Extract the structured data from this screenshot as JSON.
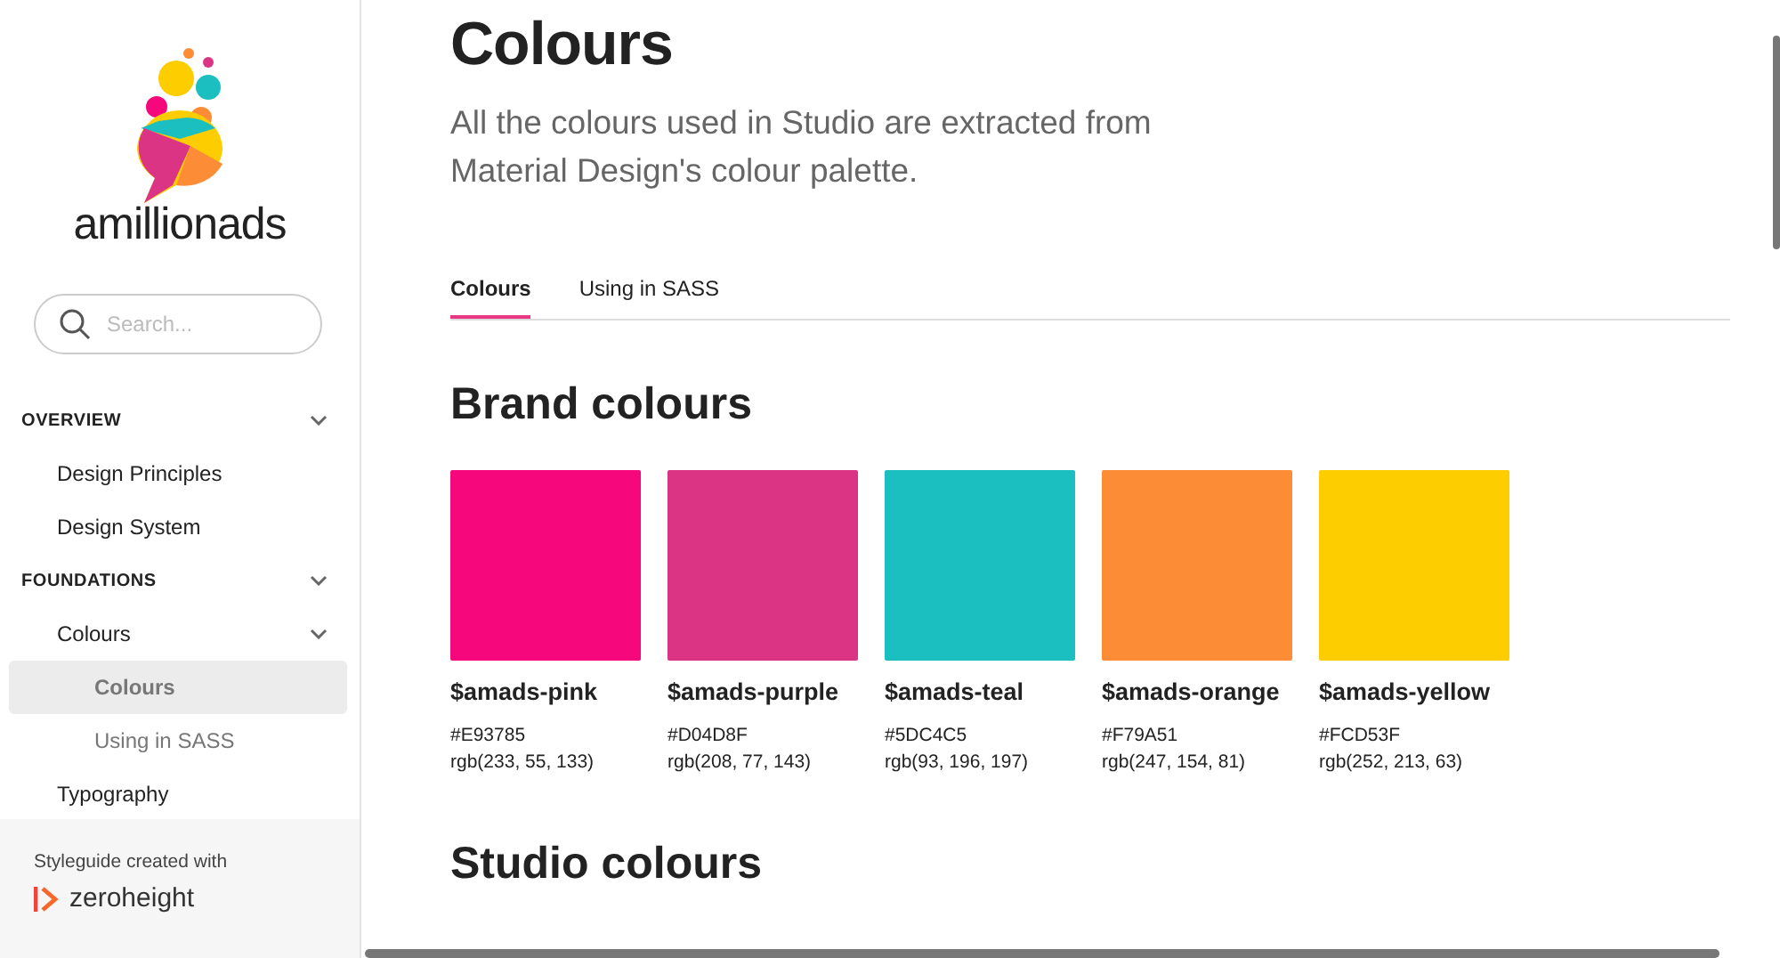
{
  "sidebar": {
    "logo": {
      "text": "amillionads"
    },
    "search": {
      "placeholder": "Search..."
    },
    "nav": [
      {
        "label": "OVERVIEW",
        "expanded": true,
        "children": [
          {
            "label": "Design Principles",
            "selected": false
          },
          {
            "label": "Design System",
            "selected": false
          }
        ]
      },
      {
        "label": "FOUNDATIONS",
        "expanded": true,
        "children": [
          {
            "label": "Colours",
            "expanded": true,
            "selected": false,
            "children": [
              {
                "label": "Colours",
                "selected": true
              },
              {
                "label": "Using in SASS",
                "selected": false
              }
            ]
          },
          {
            "label": "Typography",
            "selected": false
          }
        ]
      }
    ],
    "footer": {
      "caption": "Styleguide created with",
      "brand": "zeroheight"
    }
  },
  "page": {
    "title": "Colours",
    "intro": "All the colours used in Studio are extracted from Material Design's colour palette.",
    "tabs": [
      {
        "label": "Colours",
        "selected": true
      },
      {
        "label": "Using in SASS",
        "selected": false
      }
    ],
    "sections": [
      {
        "heading": "Brand colours",
        "swatches": [
          {
            "name": "$amads-pink",
            "hex": "#E93785",
            "rgb": "rgb(233, 55, 133)",
            "color": "#f7077c"
          },
          {
            "name": "$amads-purple",
            "hex": "#D04D8F",
            "rgb": "rgb(208, 77, 143)",
            "color": "#dc3484"
          },
          {
            "name": "$amads-teal",
            "hex": "#5DC4C5",
            "rgb": "rgb(93, 196, 197)",
            "color": "#1cbfc0"
          },
          {
            "name": "$amads-orange",
            "hex": "#F79A51",
            "rgb": "rgb(247, 154, 81)",
            "color": "#fd8c37"
          },
          {
            "name": "$amads-yellow",
            "hex": "#FCD53F",
            "rgb": "rgb(252, 213, 63)",
            "color": "#fdcd00"
          }
        ]
      },
      {
        "heading": "Studio colours"
      }
    ]
  }
}
